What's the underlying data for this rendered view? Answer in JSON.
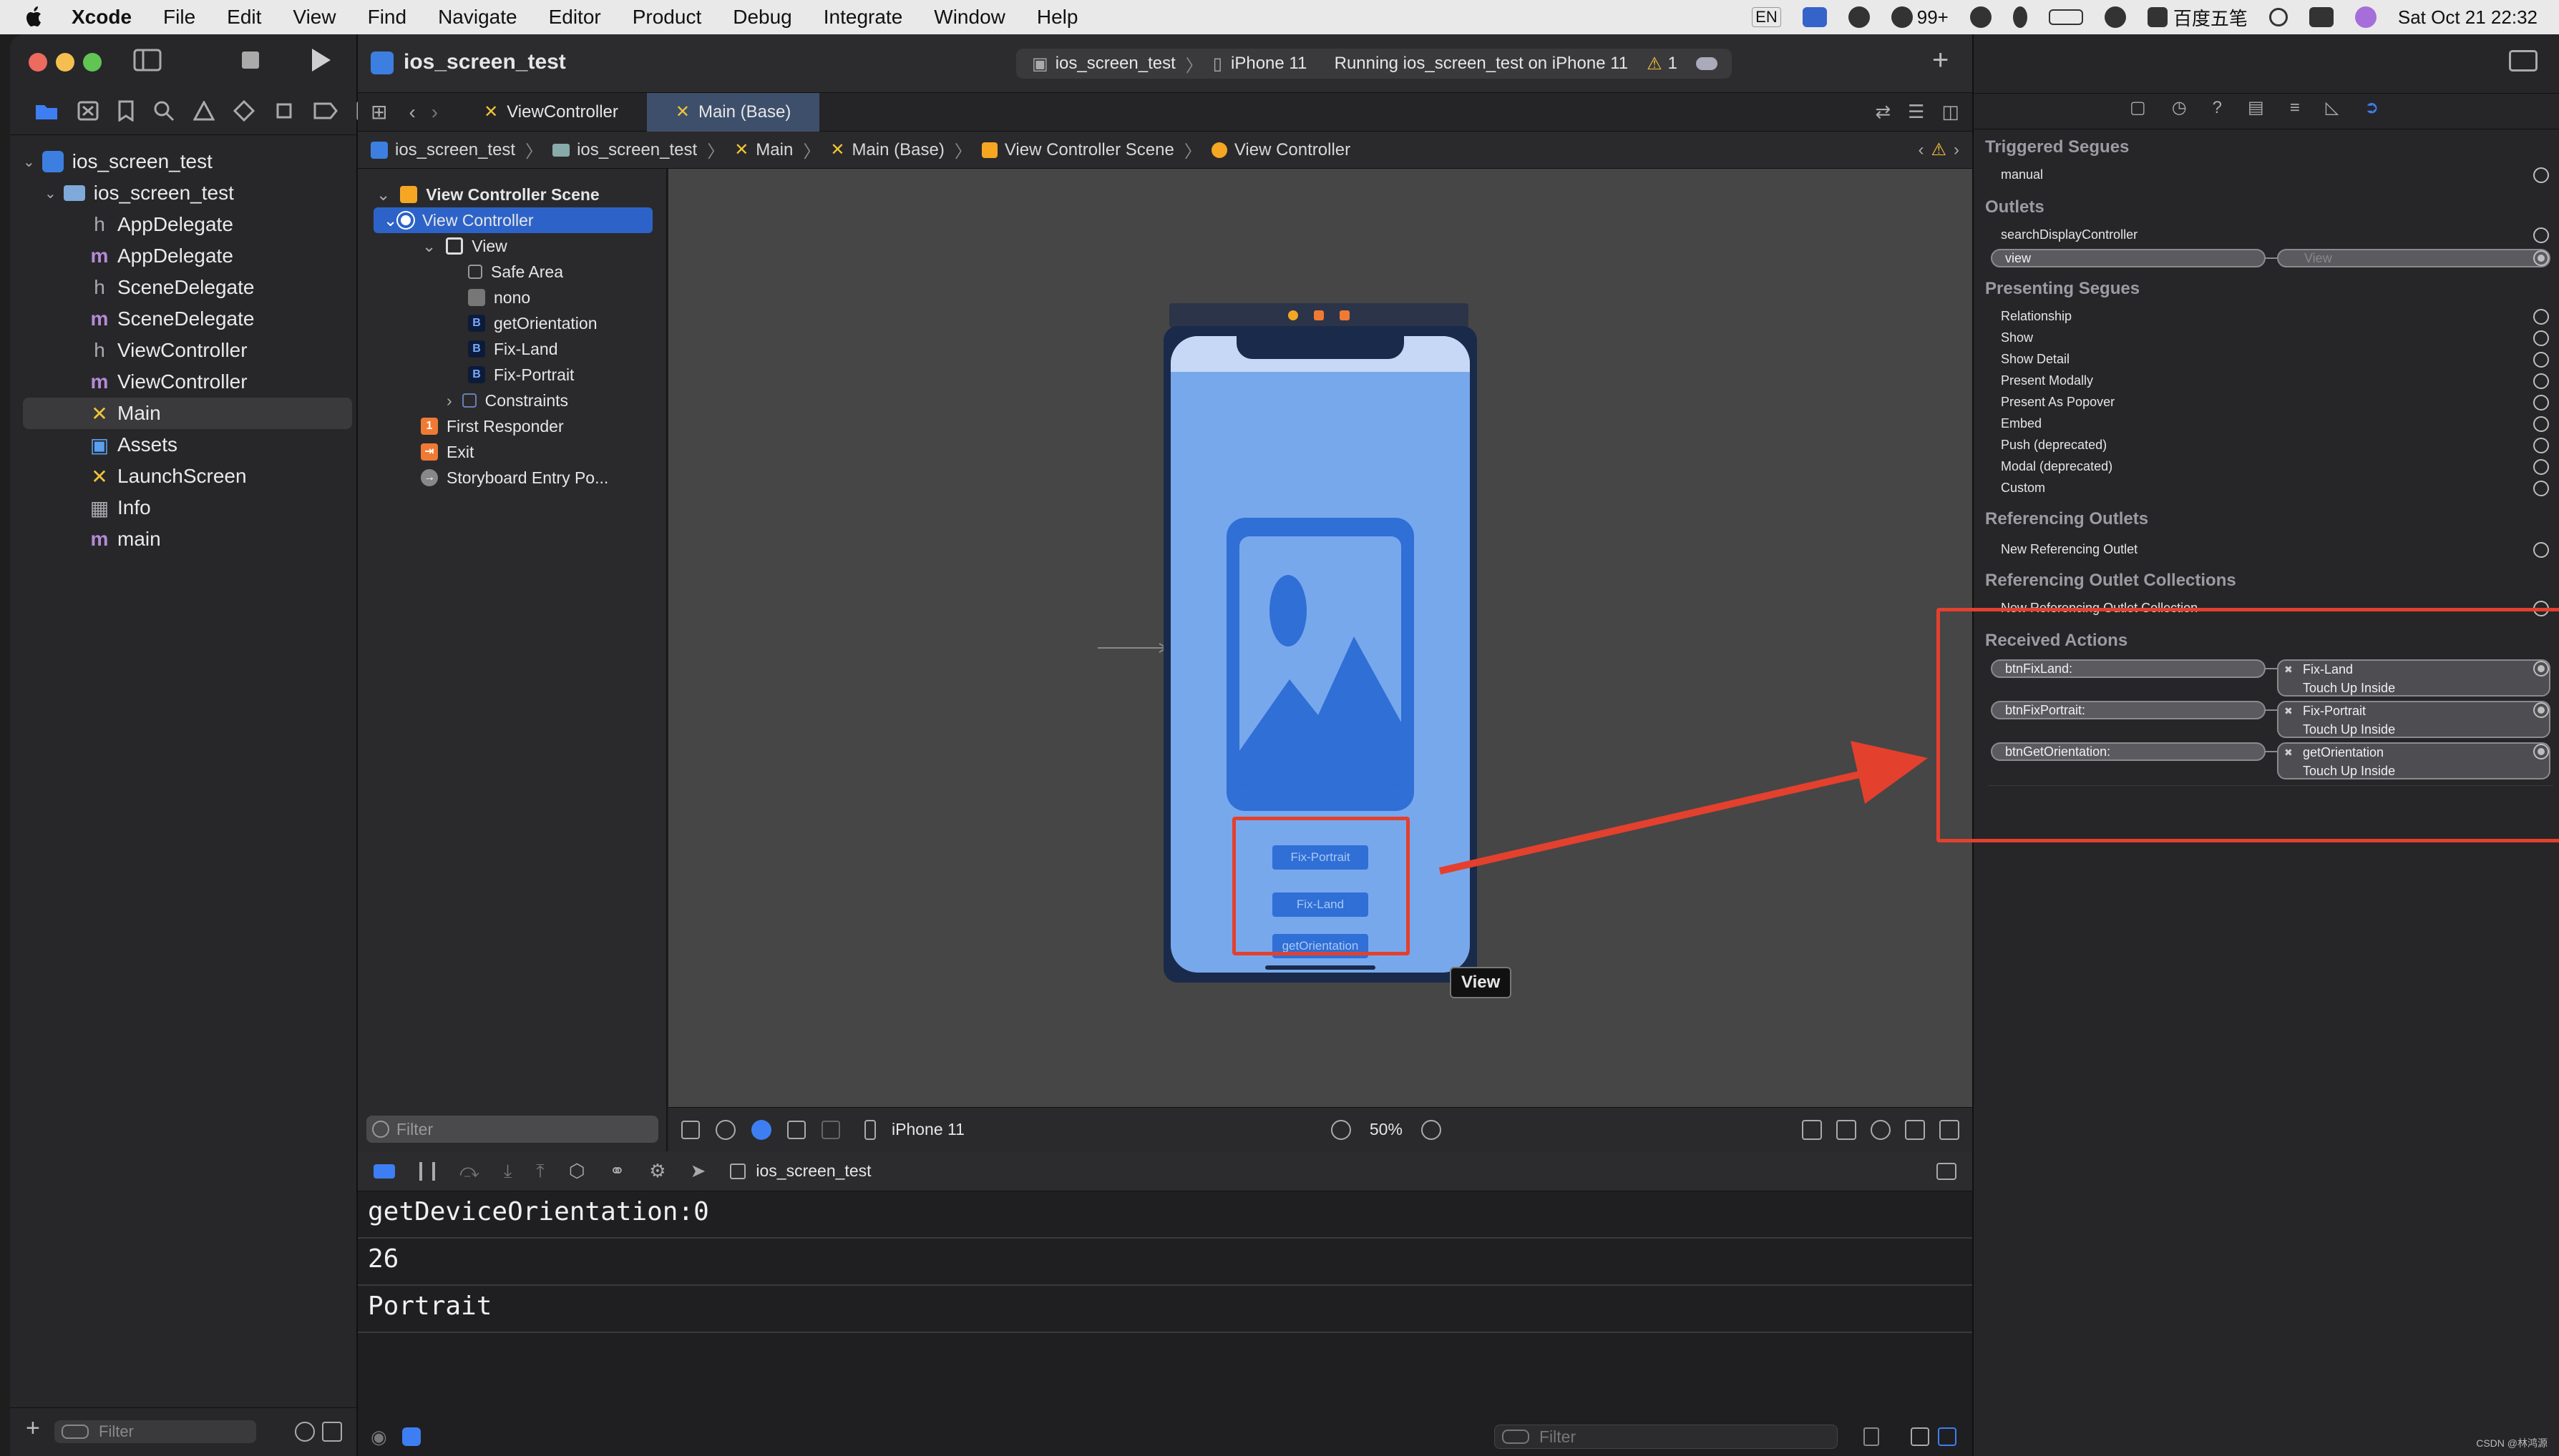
{
  "menubar": {
    "items": [
      "Xcode",
      "File",
      "Edit",
      "View",
      "Find",
      "Navigate",
      "Editor",
      "Product",
      "Debug",
      "Integrate",
      "Window",
      "Help"
    ],
    "status": {
      "input": "EN",
      "badge": "99+",
      "ime": "百度五笔",
      "datetime": "Sat Oct 21  22:32"
    }
  },
  "toolbar": {
    "project": "ios_screen_test",
    "scheme": "ios_screen_test",
    "device": "iPhone 11",
    "status": "Running ios_screen_test on iPhone 11",
    "warnings": "1"
  },
  "navigator": {
    "items": [
      {
        "label": "ios_screen_test",
        "kind": "proj"
      },
      {
        "label": "ios_screen_test",
        "kind": "folder"
      },
      {
        "label": "AppDelegate",
        "kind": "h"
      },
      {
        "label": "AppDelegate",
        "kind": "m"
      },
      {
        "label": "SceneDelegate",
        "kind": "h"
      },
      {
        "label": "SceneDelegate",
        "kind": "m"
      },
      {
        "label": "ViewController",
        "kind": "h"
      },
      {
        "label": "ViewController",
        "kind": "m"
      },
      {
        "label": "Main",
        "kind": "x"
      },
      {
        "label": "Assets",
        "kind": "assets"
      },
      {
        "label": "LaunchScreen",
        "kind": "x"
      },
      {
        "label": "Info",
        "kind": "table"
      },
      {
        "label": "main",
        "kind": "m"
      }
    ],
    "filter_placeholder": "Filter"
  },
  "tabs": [
    "ViewController",
    "Main (Base)"
  ],
  "jumpbar": [
    "ios_screen_test",
    "ios_screen_test",
    "Main",
    "Main (Base)",
    "View Controller Scene",
    "View Controller"
  ],
  "outline": {
    "items": [
      "View Controller Scene",
      "View Controller",
      "View",
      "Safe Area",
      "nono",
      "getOrientation",
      "Fix-Land",
      "Fix-Portrait",
      "Constraints",
      "First Responder",
      "Exit",
      "Storyboard Entry Po..."
    ],
    "filter_placeholder": "Filter"
  },
  "canvas": {
    "device": "iPhone 11",
    "zoom": "50%",
    "tooltip": "View",
    "buttons": [
      "Fix-Portrait",
      "Fix-Land",
      "getOrientation"
    ]
  },
  "debug": {
    "process": "ios_screen_test",
    "console": [
      "getDeviceOrientation:0",
      "26",
      "Portrait"
    ],
    "filter_placeholder": "Filter"
  },
  "inspector": {
    "triggered_title": "Triggered Segues",
    "triggered": [
      "manual"
    ],
    "outlets_title": "Outlets",
    "outlets": [
      "searchDisplayController"
    ],
    "outlet_view": "view",
    "outlet_view_target": "View",
    "presenting_title": "Presenting Segues",
    "presenting": [
      "Relationship",
      "Show",
      "Show Detail",
      "Present Modally",
      "Present As Popover",
      "Embed",
      "Push (deprecated)",
      "Modal (deprecated)",
      "Custom"
    ],
    "ref_outlets_title": "Referencing Outlets",
    "ref_outlets": [
      "New Referencing Outlet"
    ],
    "ref_collections_title": "Referencing Outlet Collections",
    "ref_collections": [
      "New Referencing Outlet Collection"
    ],
    "actions_title": "Received Actions",
    "actions": [
      {
        "name": "btnFixLand:",
        "target": "Fix-Land",
        "event": "Touch Up Inside"
      },
      {
        "name": "btnFixPortrait:",
        "target": "Fix-Portrait",
        "event": "Touch Up Inside"
      },
      {
        "name": "btnGetOrientation:",
        "target": "getOrientation",
        "event": "Touch Up Inside"
      }
    ]
  },
  "watermark": "CSDN @林鸿源"
}
